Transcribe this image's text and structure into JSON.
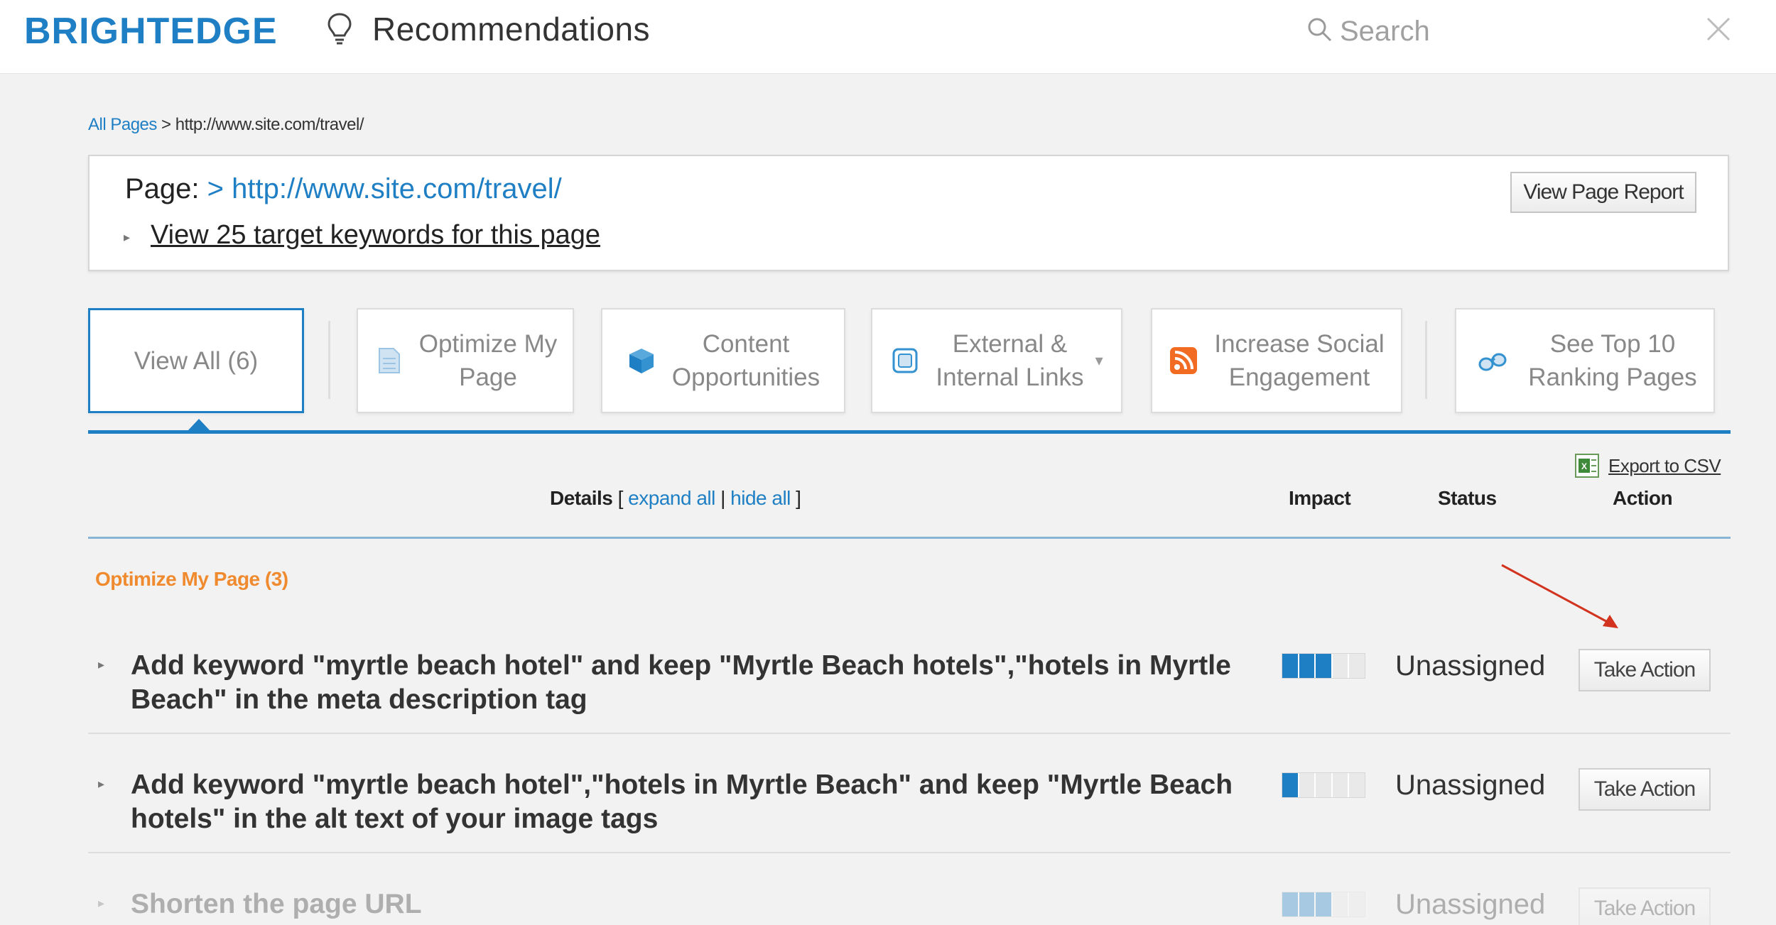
{
  "header": {
    "logo": "BRIGHTEDGE",
    "title": "Recommendations",
    "search_placeholder": "Search"
  },
  "breadcrumb": {
    "root": "All Pages",
    "separator": " > ",
    "current": "http://www.site.com/travel/"
  },
  "pagebox": {
    "label": "Page: ",
    "arrow": "> ",
    "url": "http://www.site.com/travel/",
    "keywords_link": "View 25 target keywords for this page",
    "view_report_label": "View Page Report"
  },
  "tabs": [
    {
      "label": "View All (6)",
      "icon": "none",
      "active": true
    },
    {
      "label": "Optimize My\nPage",
      "icon": "page-icon",
      "active": false
    },
    {
      "label": "Content\nOpportunities",
      "icon": "cube-icon",
      "active": false
    },
    {
      "label": "External &\nInternal Links",
      "icon": "link-icon",
      "active": false
    },
    {
      "label": "Increase Social\nEngagement",
      "icon": "rss-icon",
      "active": false
    },
    {
      "label": "See Top 10\nRanking Pages",
      "icon": "binoculars-icon",
      "active": false
    }
  ],
  "export_label": "Export to CSV",
  "columns": {
    "details": "Details",
    "bracket_open": " [ ",
    "expand_all": "expand all",
    "pipe": " | ",
    "hide_all": "hide all",
    "bracket_close": " ]",
    "impact": "Impact",
    "status": "Status",
    "action": "Action"
  },
  "section_title": "Optimize My Page (3)",
  "recommendations": [
    {
      "text": "Add keyword \"myrtle beach hotel\" and keep \"Myrtle Beach hotels\",\"hotels in Myrtle Beach\" in the meta description tag",
      "impact": 3,
      "status": "Unassigned",
      "action": "Take Action"
    },
    {
      "text": "Add keyword \"myrtle beach hotel\",\"hotels in Myrtle Beach\" and keep \"Myrtle Beach hotels\" in the alt text of your image tags",
      "impact": 1,
      "status": "Unassigned",
      "action": "Take Action"
    },
    {
      "text": "Shorten the page URL",
      "impact": 3,
      "status": "Unassigned",
      "action": "Take Action"
    }
  ],
  "impact_max": 5,
  "colors": {
    "brand": "#1f7fc4",
    "section_orange": "#f08a2e",
    "annotation_red": "#d2331e"
  }
}
